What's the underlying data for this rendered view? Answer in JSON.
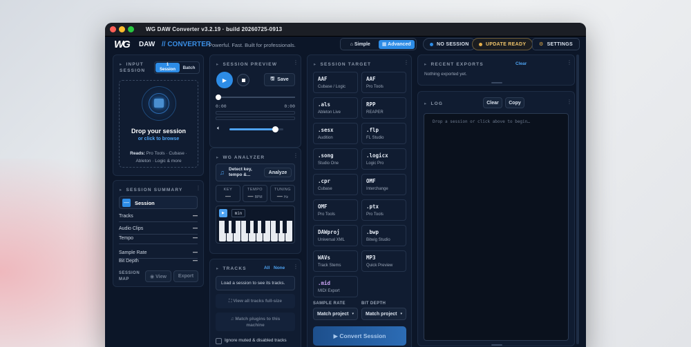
{
  "window": {
    "title": "WG DAW Converter  v3.2.19  ·  build 20260725-0913"
  },
  "header": {
    "logo": "WG",
    "app_name": "DAW",
    "app_suffix": "// CONVERTER",
    "tagline": "Powerful. Fast. Built for professionals.",
    "mode_simple": "⌂ Simple",
    "mode_advanced": "▦ Advanced",
    "session_status": "NO SESSION",
    "update_status": "UPDATE READY",
    "settings_label": "SETTINGS"
  },
  "input": {
    "title": "INPUT SESSION",
    "tab_single": "1 Session",
    "tab_batch": "Batch",
    "drop_title": "Drop your session",
    "drop_sub": "or click to browse",
    "reads_label": "Reads:",
    "reads_line1": "Pro Tools · Cubase ·",
    "reads_line2": "Ableton · Logic & more"
  },
  "summary": {
    "title": "SESSION SUMMARY",
    "session_label": "Session",
    "rows": [
      {
        "label": "Tracks",
        "value": "—"
      },
      {
        "label": "Audio Clips",
        "value": "—"
      },
      {
        "label": "Tempo",
        "value": "—"
      },
      {
        "label": "Sample Rate",
        "value": "—"
      },
      {
        "label": "Bit Depth",
        "value": "—"
      }
    ],
    "map_label": "SESSION MAP",
    "view_label": "◉ View",
    "export_label": "Export"
  },
  "preview": {
    "title": "SESSION PREVIEW",
    "save_label": "Save",
    "time_start": "0:00",
    "time_end": "0:00",
    "volume": 0.85
  },
  "analyzer": {
    "title": "WG ANALYZER",
    "detect_label": "Detect key, tempo &...",
    "analyze_label": "Analyze",
    "key_label": "KEY",
    "key_value": "—",
    "tempo_label": "TEMPO",
    "tempo_value": "—",
    "tempo_unit": "BPM",
    "tuning_label": "TUNING",
    "tuning_value": "—",
    "tuning_unit": "Hz",
    "midi_label": "min"
  },
  "tracks": {
    "title": "TRACKS",
    "all_label": "All",
    "none_label": "None",
    "empty": "Load a session to see its tracks.",
    "view_full": "⛶ View all tracks full-size",
    "match_plugins": "♫ Match plugins to this machine",
    "ignore_label": "Ignore muted & disabled tracks"
  },
  "target": {
    "title": "SESSION TARGET",
    "formats": [
      {
        "name": "AAF",
        "sub": "Cubase / Logic"
      },
      {
        "name": "AAF",
        "sub": "Pro Tools"
      },
      {
        "name": ".als",
        "sub": "Ableton Live"
      },
      {
        "name": "RPP",
        "sub": "REAPER"
      },
      {
        "name": ".sesx",
        "sub": "Audition"
      },
      {
        "name": ".flp",
        "sub": "FL Studio"
      },
      {
        "name": ".song",
        "sub": "Studio One"
      },
      {
        "name": ".logicx",
        "sub": "Logic Pro"
      },
      {
        "name": ".cpr",
        "sub": "Cubase"
      },
      {
        "name": "OMF",
        "sub": "Interchange"
      },
      {
        "name": "OMF",
        "sub": "Pro Tools"
      },
      {
        "name": ".ptx",
        "sub": "Pro Tools"
      },
      {
        "name": "DAWproj",
        "sub": "Universal XML"
      },
      {
        "name": ".bwp",
        "sub": "Bitwig Studio"
      },
      {
        "name": "WAVs",
        "sub": "Track Stems"
      },
      {
        "name": "MP3",
        "sub": "Quick Preview"
      },
      {
        "name": ".mid",
        "sub": "MIDI Export"
      }
    ],
    "sample_rate_label": "SAMPLE RATE",
    "sample_rate_value": "Match project",
    "bit_depth_label": "BIT DEPTH",
    "bit_depth_value": "Match project",
    "convert_label": "▶ Convert Session"
  },
  "exports": {
    "title": "RECENT EXPORTS",
    "clear_label": "Clear",
    "empty": "Nothing exported yet."
  },
  "log": {
    "title": "LOG",
    "clear_label": "Clear",
    "copy_label": "Copy",
    "placeholder": "Drop a session or click above to begin…"
  },
  "colors": {
    "accent": "#2d8ce6",
    "update": "#e8b04a",
    "status_dot": "#2d8ce6"
  }
}
